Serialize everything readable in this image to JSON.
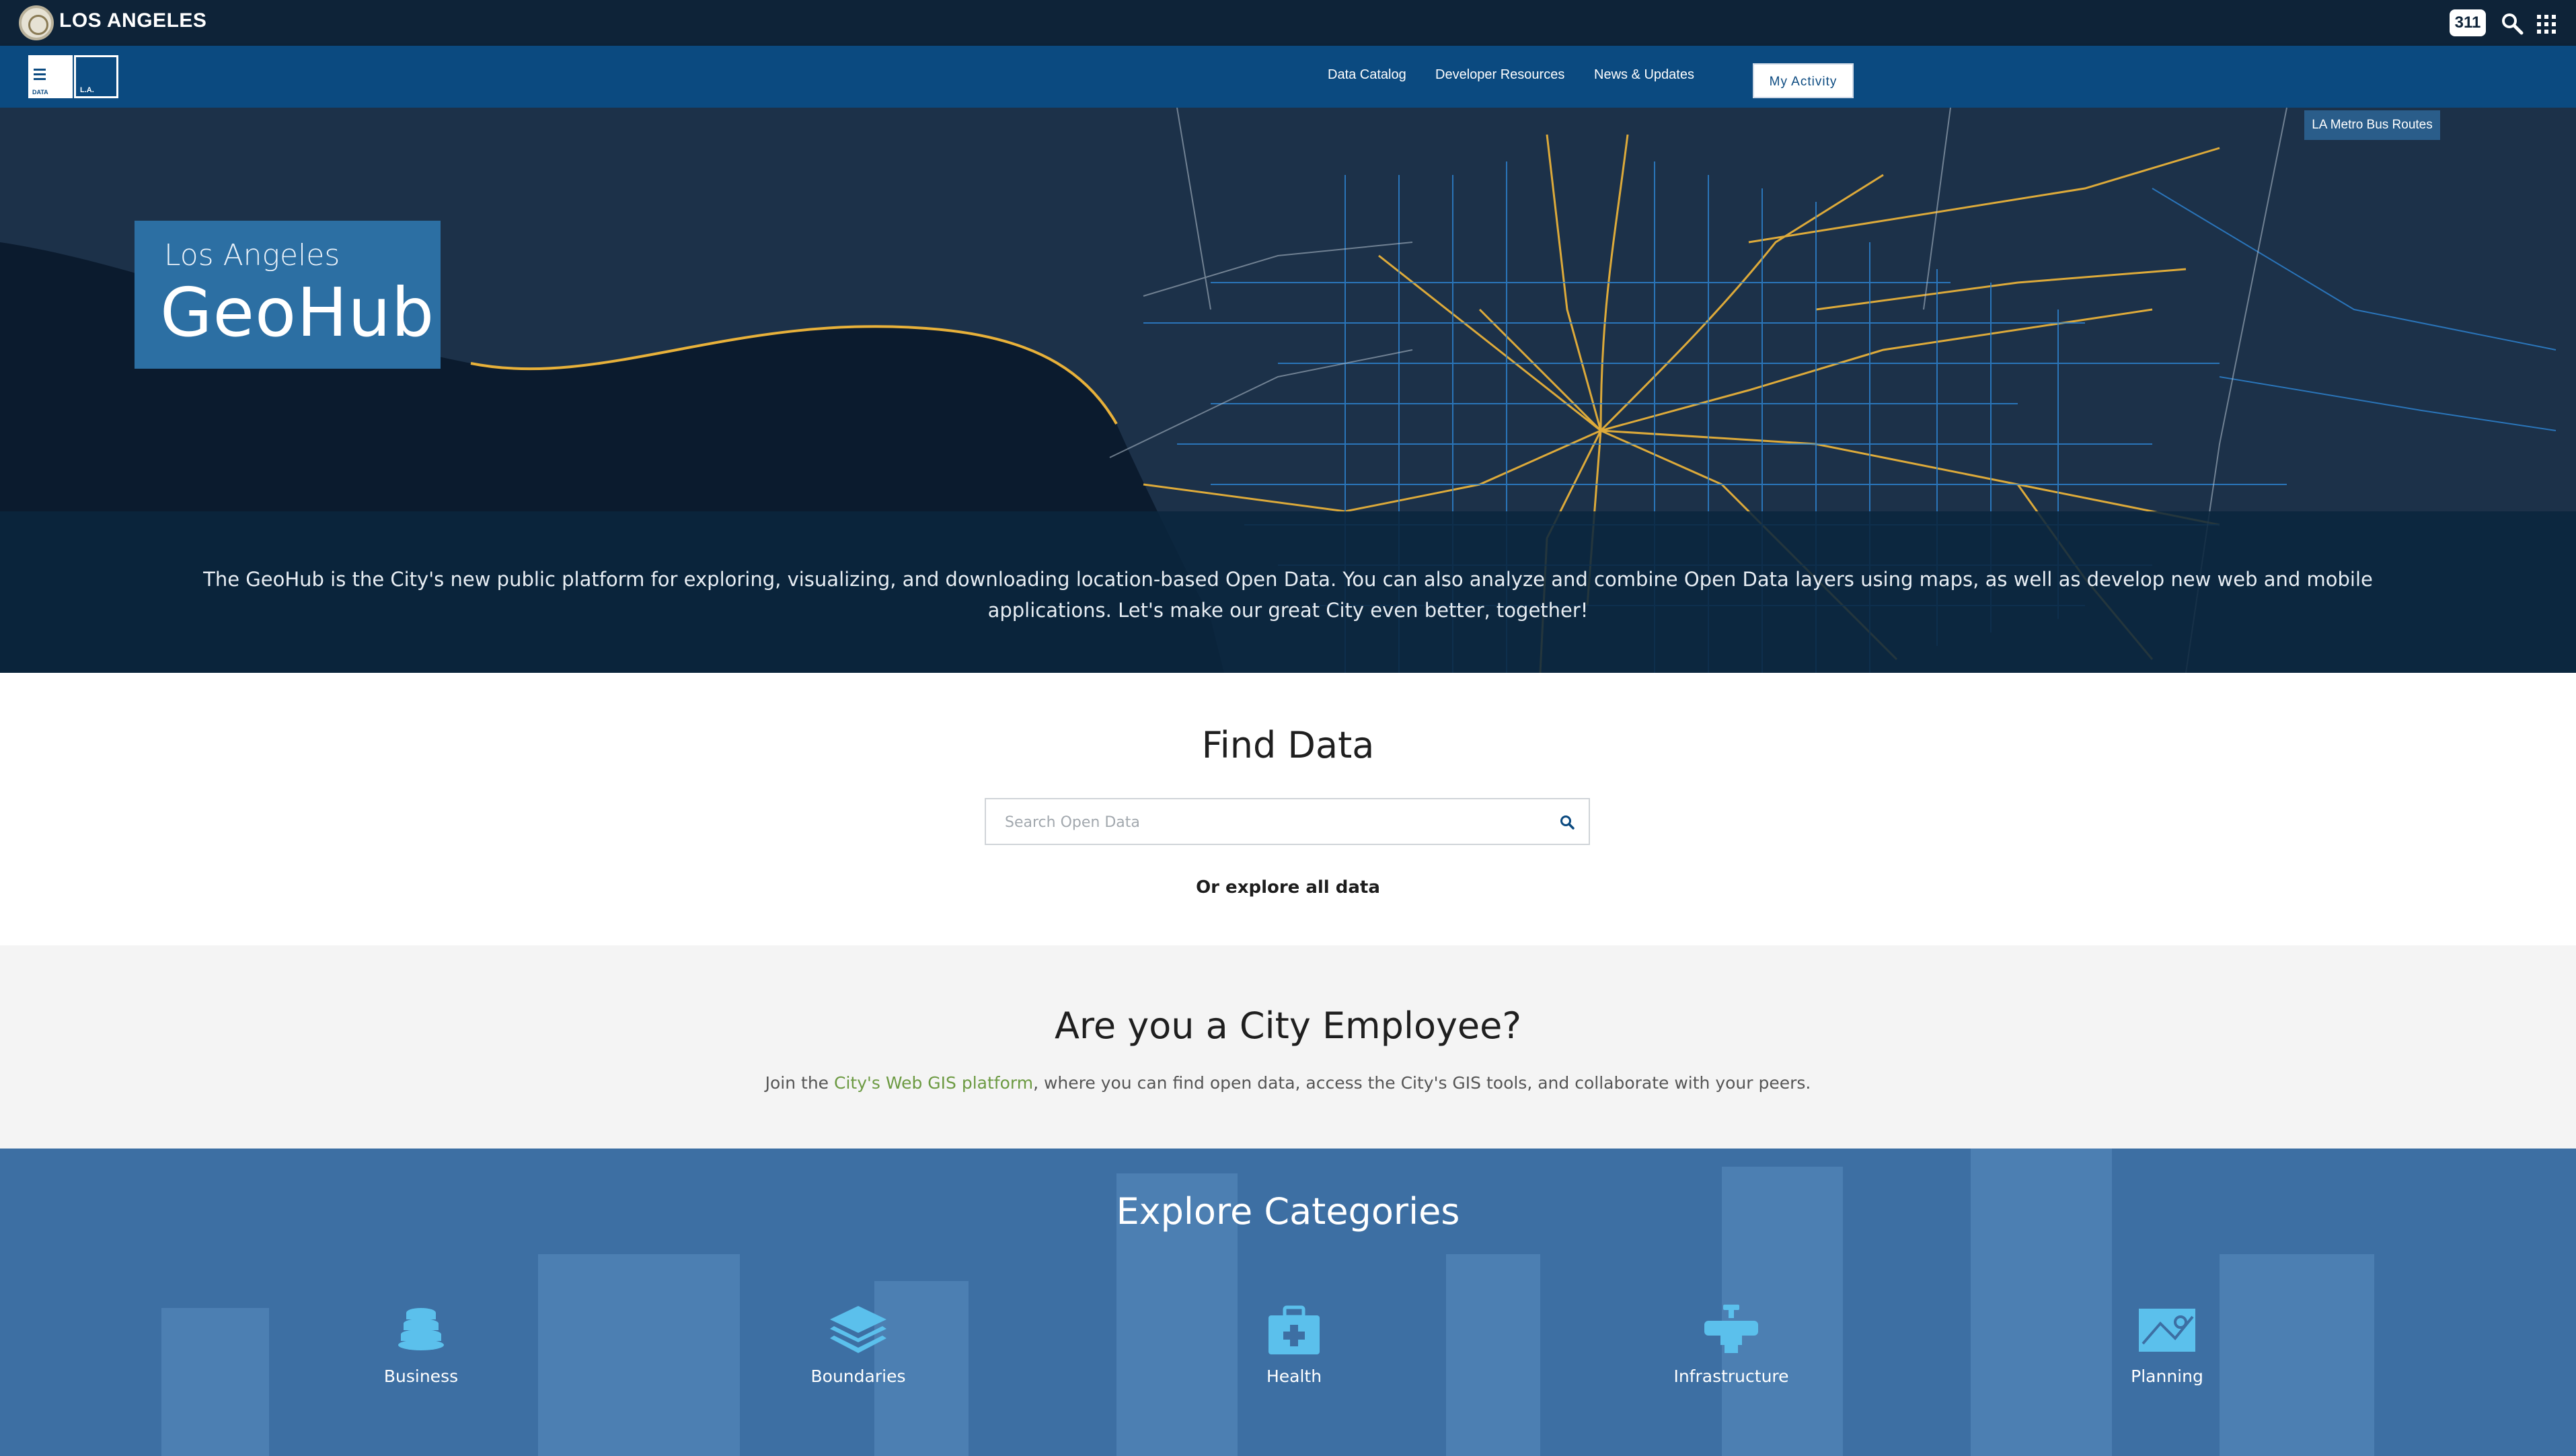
{
  "citybar": {
    "city_name": "LOS ANGELES",
    "badge_311": "311",
    "icons": [
      "city-seal-icon",
      "search-icon",
      "apps-grid-icon"
    ]
  },
  "nav": {
    "logo_data_text": "DATA",
    "logo_la_text": "L.A.",
    "links": [
      "Data Catalog",
      "Developer Resources",
      "News & Updates"
    ],
    "activity_button": "My Activity"
  },
  "hero": {
    "title_sub": "Los Angeles",
    "title_main": "GeoHub",
    "layer_label": "LA Metro Bus Routes",
    "intro": "The GeoHub is the City's new public platform for exploring, visualizing, and downloading location-based Open Data. You can also analyze and combine Open Data layers using maps, as well as develop new web and mobile applications. Let's make our great City even better, together!"
  },
  "find": {
    "heading": "Find Data",
    "search_placeholder": "Search Open Data",
    "explore_link": "Or explore all data"
  },
  "employee": {
    "heading": "Are you a City Employee?",
    "text_before": "Join the ",
    "link_text": "City's Web GIS platform",
    "text_after": ", where you can find open data, access the City's GIS tools, and collaborate with your peers."
  },
  "categories": {
    "heading": "Explore Categories",
    "items": [
      {
        "label": "Business",
        "icon": "coins-icon"
      },
      {
        "label": "Boundaries",
        "icon": "layers-icon"
      },
      {
        "label": "Health",
        "icon": "medical-kit-icon"
      },
      {
        "label": "Infrastructure",
        "icon": "water-tap-icon"
      },
      {
        "label": "Planning",
        "icon": "map-icon"
      }
    ]
  },
  "colors": {
    "city_bar": "#0e2338",
    "nav_bar": "#0b4a80",
    "title_box": "#2c6fa3",
    "routes_gold": "#e8b13a",
    "routes_blue": "#2e86d6",
    "link_green": "#6c9a42"
  }
}
